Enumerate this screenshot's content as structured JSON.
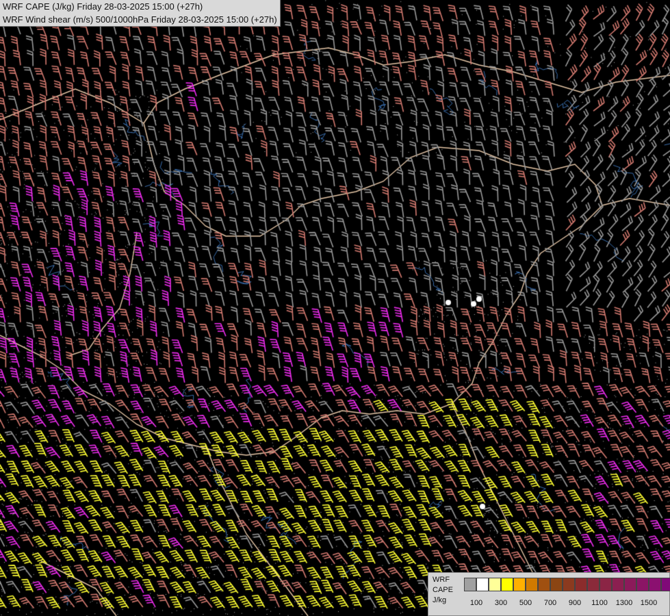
{
  "titles": {
    "line1": "WRF CAPE (J/kg) Friday 28-03-2025 15:00 (+27h)",
    "line2": "WRF Wind shear (m/s) 500/1000hPa Friday 28-03-2025 15:00 (+27h)"
  },
  "legend": {
    "label1": "WRF",
    "label2": "CAPE",
    "label3": "J/kg",
    "colors": [
      "#a0a0a0",
      "#ffffff",
      "#ffff99",
      "#ffff00",
      "#ffb000",
      "#d07a00",
      "#a05010",
      "#8b4513",
      "#8b3a1f",
      "#8b2c2c",
      "#8b2a3a",
      "#8b2545",
      "#8b1f50",
      "#8b1a5a",
      "#8b1565",
      "#8b1070",
      "#800a78"
    ],
    "tick_labels": [
      "100",
      "300",
      "500",
      "700",
      "900",
      "1100",
      "1300",
      "1500"
    ]
  },
  "map": {
    "barb_colors": {
      "weak": "#9a9a9a",
      "moderate": "#d47a70",
      "strong": "#ee2cee",
      "very_strong": "#ffff33"
    },
    "border_color": "#e8c8a8",
    "river_color": "#3a6fb0",
    "contour_color": "#bbbbbb"
  }
}
